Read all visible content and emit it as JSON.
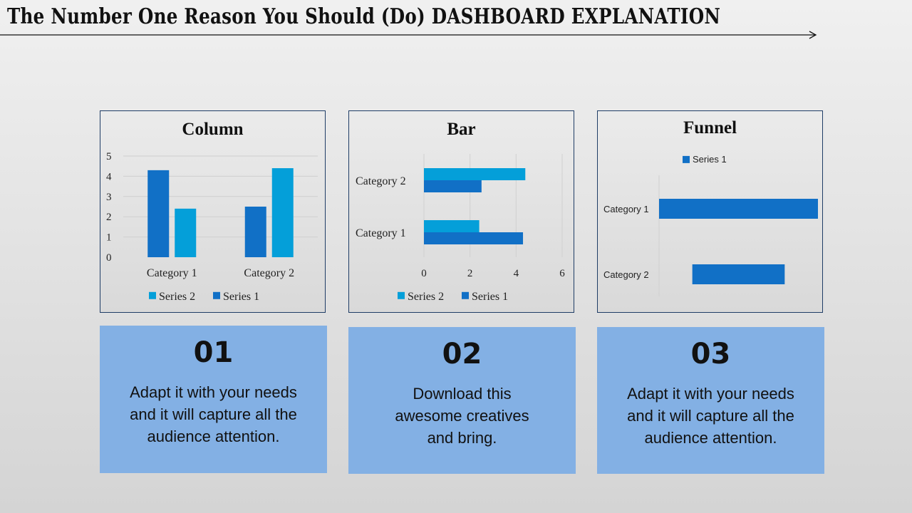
{
  "page": {
    "title": "The Number One Reason You Should (Do) DASHBOARD EXPLANATION"
  },
  "colors": {
    "series1": "#1170c6",
    "series2": "#049fd9",
    "card_bg": "#83b0e4",
    "panel_border": "#1f3d66"
  },
  "chart_data": [
    {
      "type": "bar",
      "orientation": "vertical",
      "title": "Column",
      "categories": [
        "Category 1",
        "Category 2"
      ],
      "series": [
        {
          "name": "Series 1",
          "values": [
            4.3,
            2.5
          ]
        },
        {
          "name": "Series 2",
          "values": [
            2.4,
            4.4
          ]
        }
      ],
      "yticks": [
        "0",
        "1",
        "2",
        "3",
        "4",
        "5"
      ],
      "ylim": [
        0,
        5
      ],
      "grid": true,
      "legend": [
        "Series 2",
        "Series 1"
      ],
      "legend_position": "bottom"
    },
    {
      "type": "bar",
      "orientation": "horizontal",
      "title": "Bar",
      "categories": [
        "Category 1",
        "Category 2"
      ],
      "series": [
        {
          "name": "Series 1",
          "values": [
            4.3,
            2.5
          ]
        },
        {
          "name": "Series 2",
          "values": [
            2.4,
            4.4
          ]
        }
      ],
      "xticks": [
        "0",
        "2",
        "4",
        "6"
      ],
      "xlim": [
        0,
        6
      ],
      "grid": true,
      "legend": [
        "Series 2",
        "Series 1"
      ],
      "legend_position": "bottom"
    },
    {
      "type": "bar",
      "orientation": "funnel",
      "title": "Funnel",
      "categories": [
        "Category 1",
        "Category 2"
      ],
      "series": [
        {
          "name": "Series 1",
          "values": [
            4.3,
            2.5
          ]
        }
      ],
      "legend": [
        "Series 1"
      ],
      "legend_position": "top"
    }
  ],
  "cards": [
    {
      "number": "01",
      "text": "Adapt it with your needs and it will capture all the audience attention."
    },
    {
      "number": "02",
      "text": "Download this awesome creatives and bring."
    },
    {
      "number": "03",
      "text": "Adapt it with your needs and it will capture all the audience attention."
    }
  ]
}
